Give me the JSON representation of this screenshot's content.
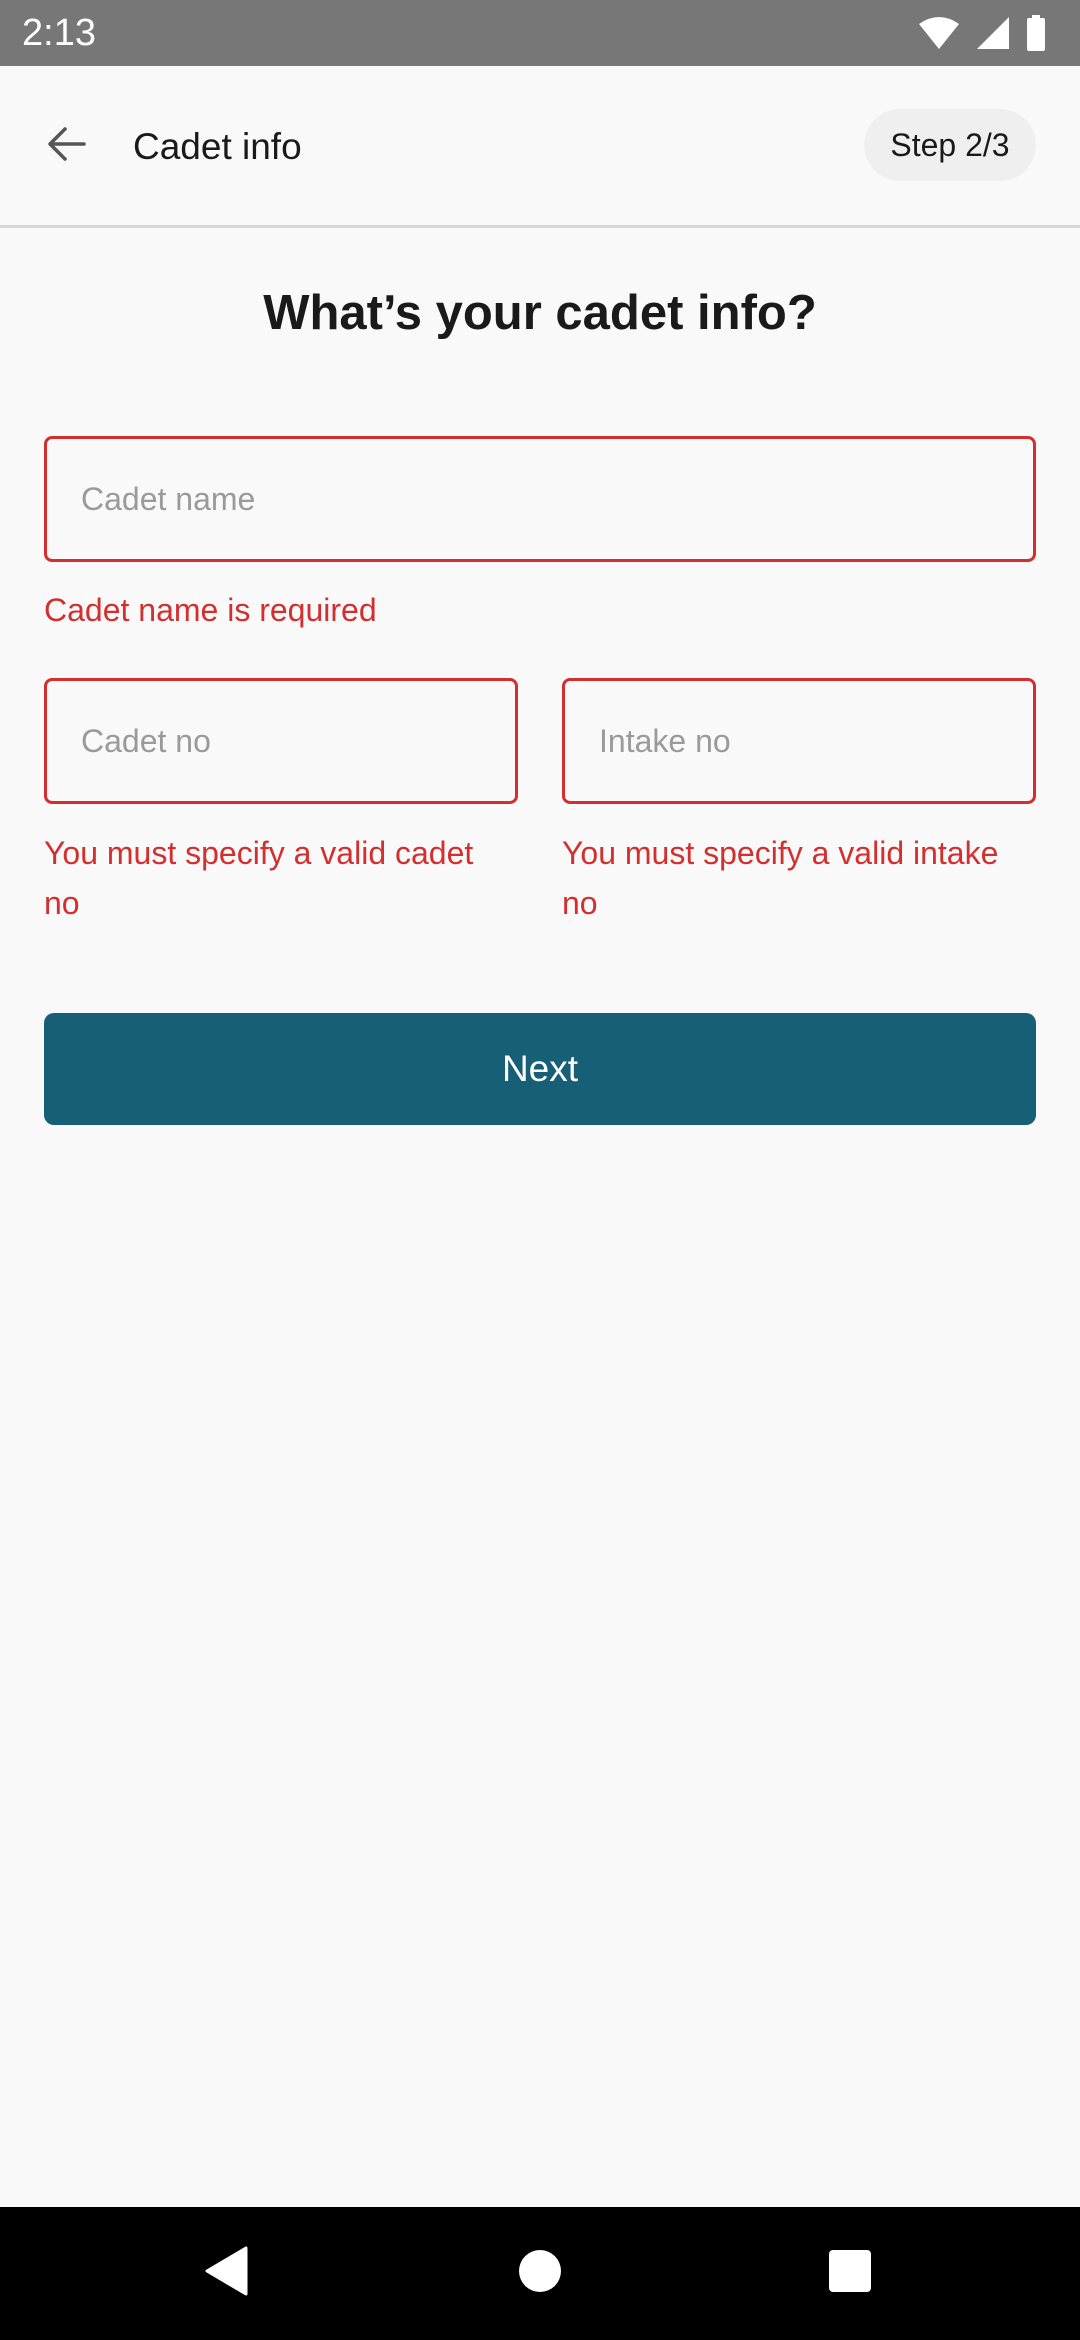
{
  "status_bar": {
    "time": "2:13",
    "icons": [
      "wifi-icon",
      "cellular-signal-icon",
      "battery-icon"
    ]
  },
  "app_bar": {
    "back_icon": "arrow-left-icon",
    "title": "Cadet info",
    "step_label": "Step 2/3"
  },
  "form": {
    "heading": "What’s your cadet info?",
    "cadet_name": {
      "value": "",
      "placeholder": "Cadet name",
      "error": "Cadet name is required"
    },
    "cadet_no": {
      "value": "",
      "placeholder": "Cadet no",
      "error_line1": "You must specify a valid cadet",
      "error_line2": "no"
    },
    "intake_no": {
      "value": "",
      "placeholder": "Intake no",
      "error_line1": "You must specify a valid intake",
      "error_line2": "no"
    },
    "next_label": "Next"
  },
  "nav_bar": {
    "buttons": [
      "back-triangle-icon",
      "home-circle-icon",
      "recents-square-icon"
    ]
  },
  "colors": {
    "accent": "#175f77",
    "error": "#d32f2f",
    "status_bar": "#777777",
    "background": "#f9f9f9"
  }
}
